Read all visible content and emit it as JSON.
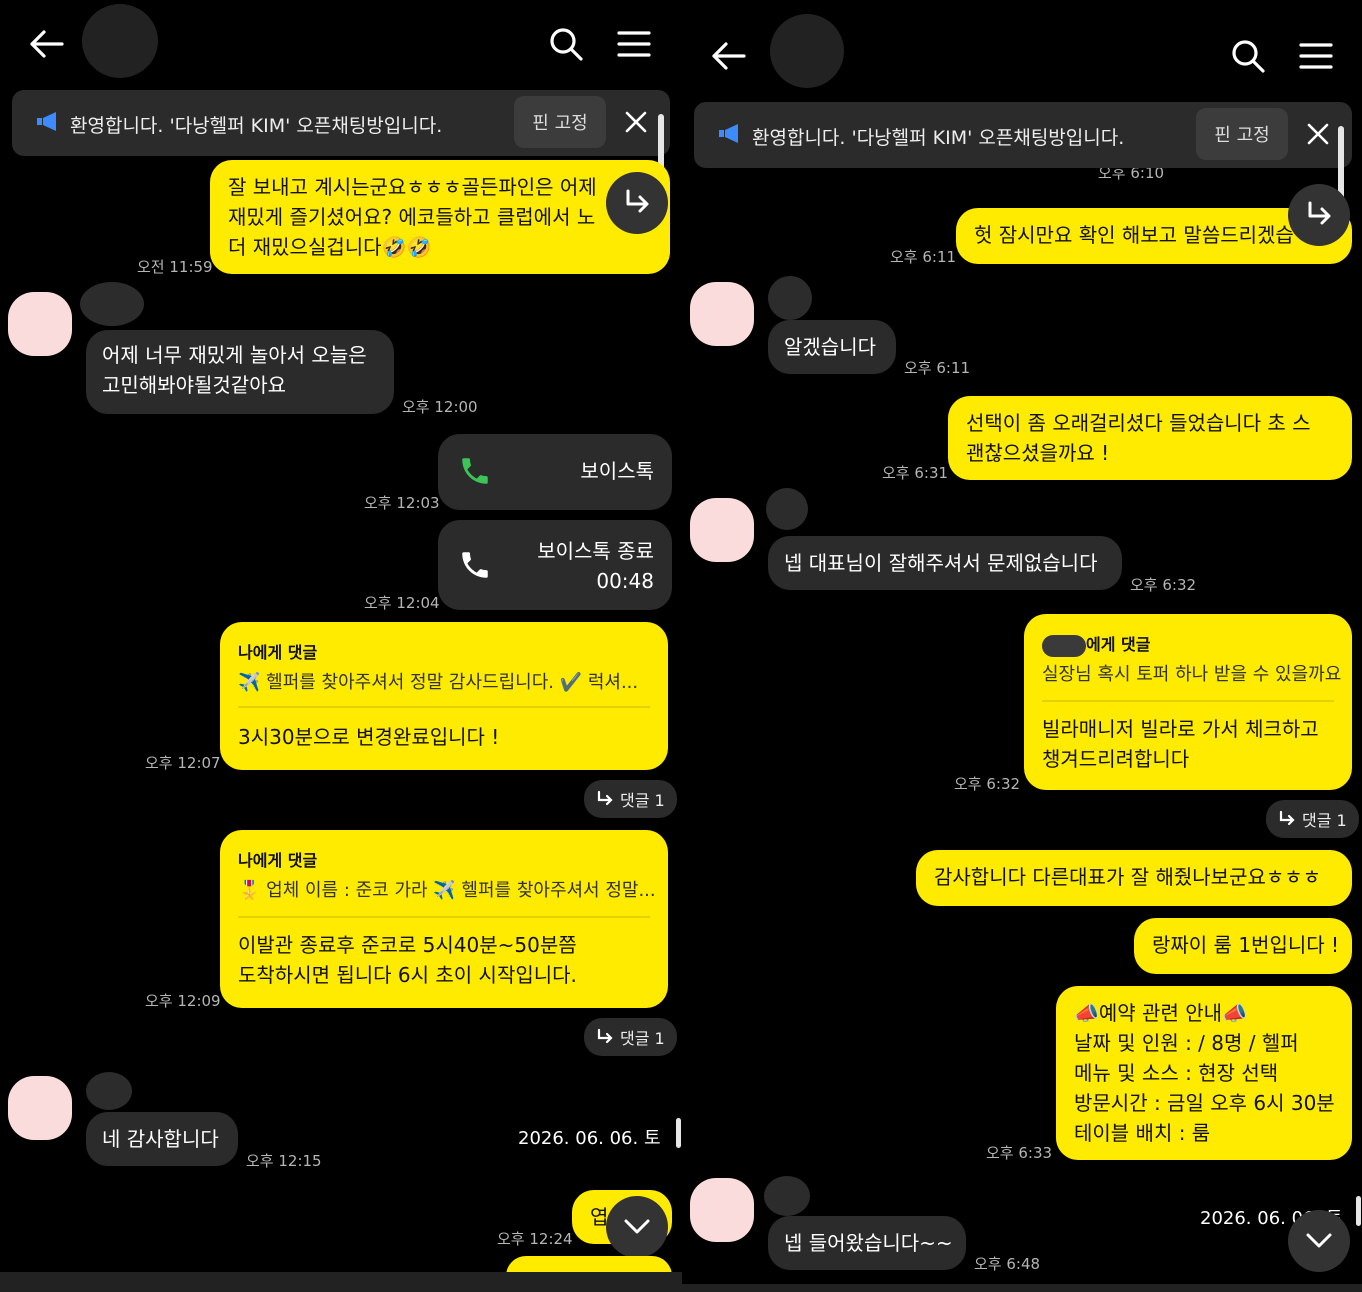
{
  "colors": {
    "accent_yellow": "#ffeb00",
    "bubble_dark": "#2b2b2b",
    "call_green": "#3bc458",
    "notice_blue": "#3d8bff",
    "avatar_pink": "#fadcdc"
  },
  "left": {
    "notice": {
      "text": "환영합니다. '다낭헬퍼 KIM' 오픈채팅방입니다.",
      "pin_label": "핀 고정"
    },
    "messages": {
      "m1": {
        "line1": "잘 보내고 계시는군요ㅎㅎㅎ골든파인은 어제",
        "line2": "재밌게 즐기셨어요? 에코들하고 클럽에서 노",
        "line3": "더 재밌으실겁니다🤣🤣",
        "time": "오전 11:59"
      },
      "m2": {
        "line1": "어제 너무 재밌게 놀아서 오늘은",
        "line2": "고민해봐야될것같아요",
        "time": "오후 12:00"
      },
      "m3": {
        "label": "보이스톡",
        "time": "오후 12:03"
      },
      "m4": {
        "label": "보이스톡 종료",
        "duration": "00:48",
        "time": "오후 12:04"
      },
      "m5": {
        "tag": "나에게 댓글",
        "quote": "✈️ 헬퍼를 찾아주셔서 정말 감사드립니다.  ✔️ 럭셔...",
        "body": "3시30분으로 변경완료입니다 !",
        "time": "오후 12:07",
        "comments": "댓글 1"
      },
      "m6": {
        "tag": "나에게 댓글",
        "quote": "🎖️ 업체 이름 : 준코 가라  ✈️ 헬퍼를 찾아주셔서 정말...",
        "line1": "이발관 종료후 준코로 5시40분~50분쯤",
        "line2": "도착하시면 됩니다 6시 초이  시작입니다.",
        "time": "오후 12:09",
        "comments": "댓글 1"
      },
      "m7": {
        "text": "네 감사합니다",
        "time": "오후 12:15"
      },
      "m8": {
        "text": "엽",
        "time": "오후 12:24"
      }
    },
    "date_chip": "2026. 06. 06. 토"
  },
  "right": {
    "notice": {
      "text": "환영합니다. '다낭헬퍼 KIM' 오픈채팅방입니다.",
      "pin_label": "핀 고정"
    },
    "messages": {
      "r0": {
        "time": "오후 6:10"
      },
      "r1": {
        "text": "헛 잠시만요 확인 해보고 말씀드리겠습",
        "time": "오후 6:11"
      },
      "r2": {
        "text": "알겠습니다",
        "time": "오후 6:11"
      },
      "r3": {
        "line1": "선택이 좀 오래걸리셨다 들었습니다 초   스",
        "line2": "괜찮으셨을까요 !",
        "time": "오후 6:31"
      },
      "r4": {
        "text": "넵 대표님이 잘해주셔서 문제없습니다",
        "time": "오후 6:32"
      },
      "r5": {
        "tag": "에게 댓글",
        "quote": "실장님 혹시 토퍼 하나 받을 수 있을까요",
        "line1": "빌라매니저 빌라로 가서 체크하고",
        "line2": "챙겨드리려합니다",
        "time": "오후 6:32",
        "comments": "댓글 1"
      },
      "r6": {
        "text": "감사합니다 다른대표가 잘 해줬나보군요ㅎㅎㅎ"
      },
      "r7": {
        "text": "랑짜이 룸 1번입니다 !"
      },
      "r8": {
        "line1": "📣예약 관련 안내📣",
        "line2": "날짜 및 인원 :  / 8명 / 헬퍼",
        "line3": "메뉴 및 소스 : 현장 선택",
        "line4": "방문시간 : 금일 오후 6시 30분",
        "line5": "테이블 배치 : 룸",
        "time": "오후 6:33"
      },
      "r9": {
        "text": "넵 들어왔습니다~~",
        "time": "오후 6:48"
      }
    },
    "date_chip": "2026. 06. 06. 토"
  }
}
